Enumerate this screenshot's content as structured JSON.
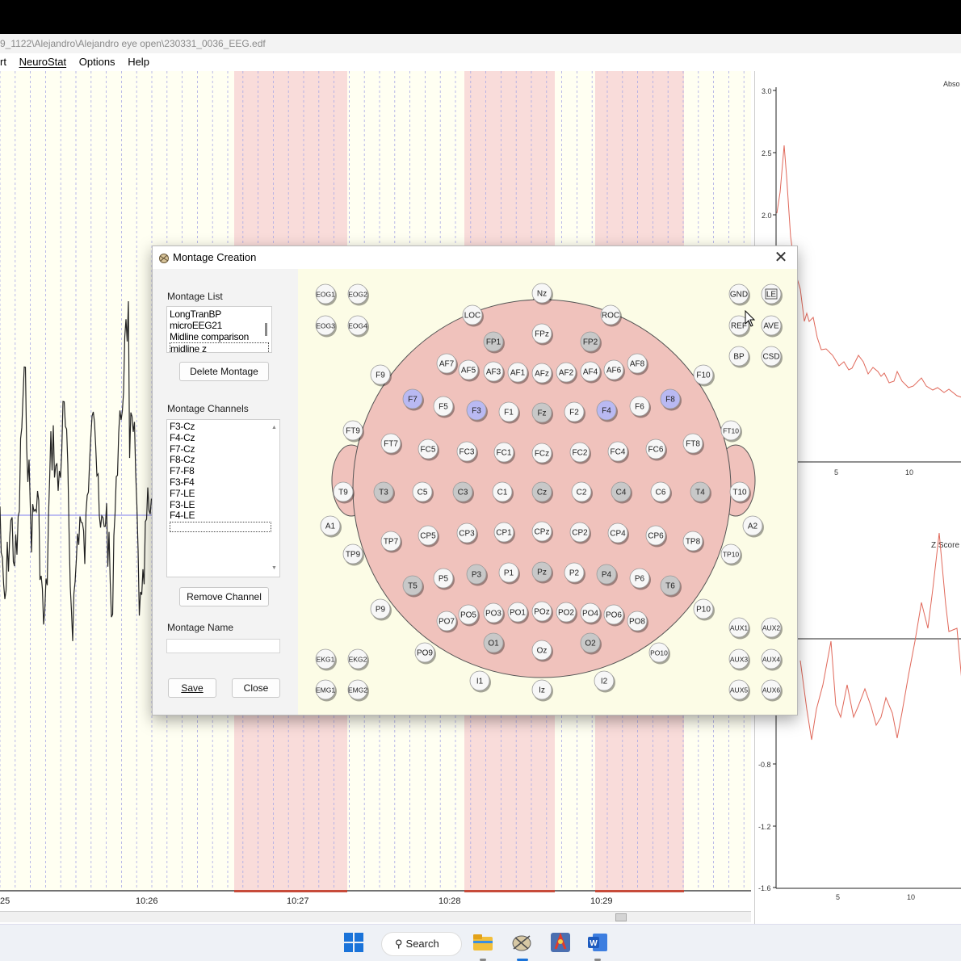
{
  "window": {
    "title_path": "9_1122\\Alejandro\\Alejandro eye open\\230331_0036_EEG.edf"
  },
  "menubar": [
    "rt",
    "NeuroStat",
    "Options",
    "Help"
  ],
  "eeg": {
    "time_labels": [
      "25",
      "10:26",
      "10:27",
      "10:28",
      "10:29"
    ]
  },
  "right_panel": {
    "top_title": "Abso",
    "top_yticks": [
      "3.0",
      "2.5",
      "2.0"
    ],
    "top_xticks": [
      "5",
      "10"
    ],
    "bottom_title": "Z Score",
    "bottom_yticks": [
      "-0.8",
      "-1.2",
      "-1.6"
    ],
    "bottom_xticks": [
      "5",
      "10"
    ]
  },
  "dialog": {
    "title": "Montage Creation",
    "close_glyph": "✕",
    "montage_list_label": "Montage List",
    "montage_list": [
      "LongTranBP",
      "microEEG21",
      "Midline comparison",
      "midline z"
    ],
    "montage_list_selected": "midline z",
    "delete_button": "Delete Montage",
    "channels_label": "Montage Channels",
    "channels": [
      "F3-Cz",
      "F4-Cz",
      "F7-Cz",
      "F8-Cz",
      "F7-F8",
      "F3-F4",
      "F7-LE",
      "F3-LE",
      "F4-LE"
    ],
    "remove_button": "Remove Channel",
    "name_label": "Montage Name",
    "name_value": "",
    "save_button": "Save",
    "close_button": "Close"
  },
  "electrodes": {
    "highlight_color": "#b9b9f2",
    "gray_color": "#c8c8c8",
    "default_color": "#f7f7f7",
    "head_color": "#f0c2bc",
    "list": [
      {
        "label": "Nz",
        "style": "default"
      },
      {
        "label": "EOG1",
        "style": "default"
      },
      {
        "label": "EOG2",
        "style": "default"
      },
      {
        "label": "EOG3",
        "style": "default"
      },
      {
        "label": "EOG4",
        "style": "default"
      },
      {
        "label": "GND",
        "style": "default"
      },
      {
        "label": "LE",
        "style": "boxed"
      },
      {
        "label": "REF",
        "style": "default"
      },
      {
        "label": "AVE",
        "style": "default"
      },
      {
        "label": "BP",
        "style": "default"
      },
      {
        "label": "CSD",
        "style": "default"
      },
      {
        "label": "LOC",
        "style": "default"
      },
      {
        "label": "ROC",
        "style": "default"
      },
      {
        "label": "FP1",
        "style": "gray"
      },
      {
        "label": "FPz",
        "style": "default"
      },
      {
        "label": "FP2",
        "style": "gray"
      },
      {
        "label": "AF7",
        "style": "default"
      },
      {
        "label": "AF5",
        "style": "default"
      },
      {
        "label": "AF3",
        "style": "default"
      },
      {
        "label": "AF1",
        "style": "default"
      },
      {
        "label": "AFz",
        "style": "default"
      },
      {
        "label": "AF2",
        "style": "default"
      },
      {
        "label": "AF4",
        "style": "default"
      },
      {
        "label": "AF6",
        "style": "default"
      },
      {
        "label": "AF8",
        "style": "default"
      },
      {
        "label": "F9",
        "style": "default"
      },
      {
        "label": "F10",
        "style": "default"
      },
      {
        "label": "F7",
        "style": "highlight"
      },
      {
        "label": "F5",
        "style": "default"
      },
      {
        "label": "F3",
        "style": "highlight"
      },
      {
        "label": "F1",
        "style": "default"
      },
      {
        "label": "Fz",
        "style": "gray"
      },
      {
        "label": "F2",
        "style": "default"
      },
      {
        "label": "F4",
        "style": "highlight"
      },
      {
        "label": "F6",
        "style": "default"
      },
      {
        "label": "F8",
        "style": "highlight"
      },
      {
        "label": "FT9",
        "style": "default"
      },
      {
        "label": "FT10",
        "style": "default"
      },
      {
        "label": "FT7",
        "style": "default"
      },
      {
        "label": "FC5",
        "style": "default"
      },
      {
        "label": "FC3",
        "style": "default"
      },
      {
        "label": "FC1",
        "style": "default"
      },
      {
        "label": "FCz",
        "style": "default"
      },
      {
        "label": "FC2",
        "style": "default"
      },
      {
        "label": "FC4",
        "style": "default"
      },
      {
        "label": "FC6",
        "style": "default"
      },
      {
        "label": "FT8",
        "style": "default"
      },
      {
        "label": "T9",
        "style": "default"
      },
      {
        "label": "T3",
        "style": "gray"
      },
      {
        "label": "C5",
        "style": "default"
      },
      {
        "label": "C3",
        "style": "gray"
      },
      {
        "label": "C1",
        "style": "default"
      },
      {
        "label": "Cz",
        "style": "gray"
      },
      {
        "label": "C2",
        "style": "default"
      },
      {
        "label": "C4",
        "style": "gray"
      },
      {
        "label": "C6",
        "style": "default"
      },
      {
        "label": "T4",
        "style": "gray"
      },
      {
        "label": "T10",
        "style": "default"
      },
      {
        "label": "A1",
        "style": "default"
      },
      {
        "label": "A2",
        "style": "default"
      },
      {
        "label": "TP7",
        "style": "default"
      },
      {
        "label": "CP5",
        "style": "default"
      },
      {
        "label": "CP3",
        "style": "default"
      },
      {
        "label": "CP1",
        "style": "default"
      },
      {
        "label": "CPz",
        "style": "default"
      },
      {
        "label": "CP2",
        "style": "default"
      },
      {
        "label": "CP4",
        "style": "default"
      },
      {
        "label": "CP6",
        "style": "default"
      },
      {
        "label": "TP8",
        "style": "default"
      },
      {
        "label": "TP9",
        "style": "default"
      },
      {
        "label": "TP10",
        "style": "default"
      },
      {
        "label": "T5",
        "style": "gray"
      },
      {
        "label": "P5",
        "style": "default"
      },
      {
        "label": "P3",
        "style": "gray"
      },
      {
        "label": "P1",
        "style": "default"
      },
      {
        "label": "Pz",
        "style": "gray"
      },
      {
        "label": "P2",
        "style": "default"
      },
      {
        "label": "P4",
        "style": "gray"
      },
      {
        "label": "P6",
        "style": "default"
      },
      {
        "label": "T6",
        "style": "gray"
      },
      {
        "label": "P9",
        "style": "default"
      },
      {
        "label": "P10",
        "style": "default"
      },
      {
        "label": "PO7",
        "style": "default"
      },
      {
        "label": "PO5",
        "style": "default"
      },
      {
        "label": "PO3",
        "style": "default"
      },
      {
        "label": "PO1",
        "style": "default"
      },
      {
        "label": "POz",
        "style": "default"
      },
      {
        "label": "PO2",
        "style": "default"
      },
      {
        "label": "PO4",
        "style": "default"
      },
      {
        "label": "PO6",
        "style": "default"
      },
      {
        "label": "PO8",
        "style": "default"
      },
      {
        "label": "O1",
        "style": "gray"
      },
      {
        "label": "Oz",
        "style": "default"
      },
      {
        "label": "O2",
        "style": "gray"
      },
      {
        "label": "PO9",
        "style": "default"
      },
      {
        "label": "PO10",
        "style": "default"
      },
      {
        "label": "I1",
        "style": "default"
      },
      {
        "label": "Iz",
        "style": "default"
      },
      {
        "label": "I2",
        "style": "default"
      },
      {
        "label": "EKG1",
        "style": "default"
      },
      {
        "label": "EKG2",
        "style": "default"
      },
      {
        "label": "EMG1",
        "style": "default"
      },
      {
        "label": "EMG2",
        "style": "default"
      },
      {
        "label": "AUX1",
        "style": "default"
      },
      {
        "label": "AUX2",
        "style": "default"
      },
      {
        "label": "AUX3",
        "style": "default"
      },
      {
        "label": "AUX4",
        "style": "default"
      },
      {
        "label": "AUX5",
        "style": "default"
      },
      {
        "label": "AUX6",
        "style": "default"
      }
    ]
  },
  "taskbar": {
    "search_label": "Search",
    "icons": [
      "windows-start-icon",
      "file-explorer-icon",
      "neuroguide-app-icon",
      "app-icon",
      "word-icon"
    ]
  }
}
